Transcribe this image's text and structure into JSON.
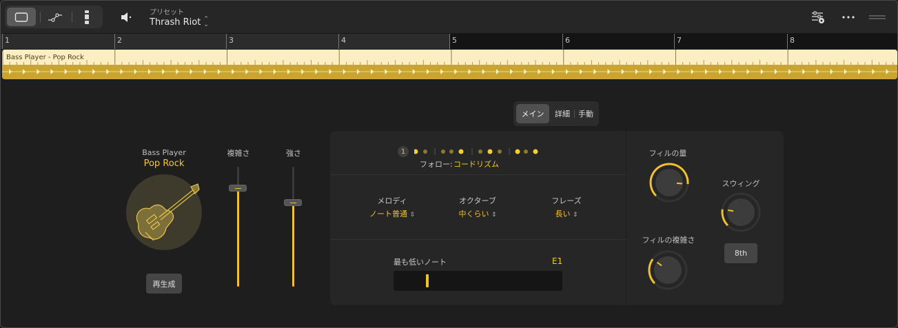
{
  "toolbar": {
    "view_buttons": [
      {
        "icon": "region-view-icon",
        "active": true
      },
      {
        "icon": "automation-icon",
        "active": false
      },
      {
        "icon": "split-view-icon",
        "active": false
      }
    ],
    "speaker_icon": "speaker-icon",
    "preset_caption": "プリセット",
    "preset_value": "Thrash Riot",
    "right_icons": [
      "settings-sliders-icon",
      "more-icon",
      "drag-handle-icon"
    ]
  },
  "ruler": {
    "bars": [
      "1",
      "2",
      "3",
      "4",
      "5",
      "6",
      "7",
      "8"
    ]
  },
  "region": {
    "title": "Bass Player - Pop Rock",
    "color": "#c9a42f"
  },
  "tabs": {
    "main": "メイン",
    "details": "詳細",
    "manual": "手動"
  },
  "player": {
    "name_caption": "Bass Player",
    "style": "Pop Rock",
    "regenerate": "再生成"
  },
  "sliders": {
    "complexity_label": "複雑さ",
    "complexity_value": 0.82,
    "intensity_label": "強さ",
    "intensity_value": 0.7
  },
  "follow": {
    "beat_number": "1",
    "label": "フォロー:",
    "value": "コードリズム"
  },
  "params": {
    "melody_label": "メロディ",
    "melody_value": "ノート普通",
    "octave_label": "オクターブ",
    "octave_value": "中くらい",
    "phrase_label": "フレーズ",
    "phrase_value": "長い"
  },
  "lowest_note": {
    "label": "最も低いノート",
    "value": "E1",
    "position": 0.2
  },
  "knobs": {
    "fill_amount_label": "フィルの量",
    "fill_amount_value": 0.85,
    "fill_complexity_label": "フィルの複雑さ",
    "fill_complexity_value": 0.3,
    "swing_label": "スウィング",
    "swing_value": 0.2,
    "swing_button": "8th"
  },
  "accent_color": "#f2c12e"
}
